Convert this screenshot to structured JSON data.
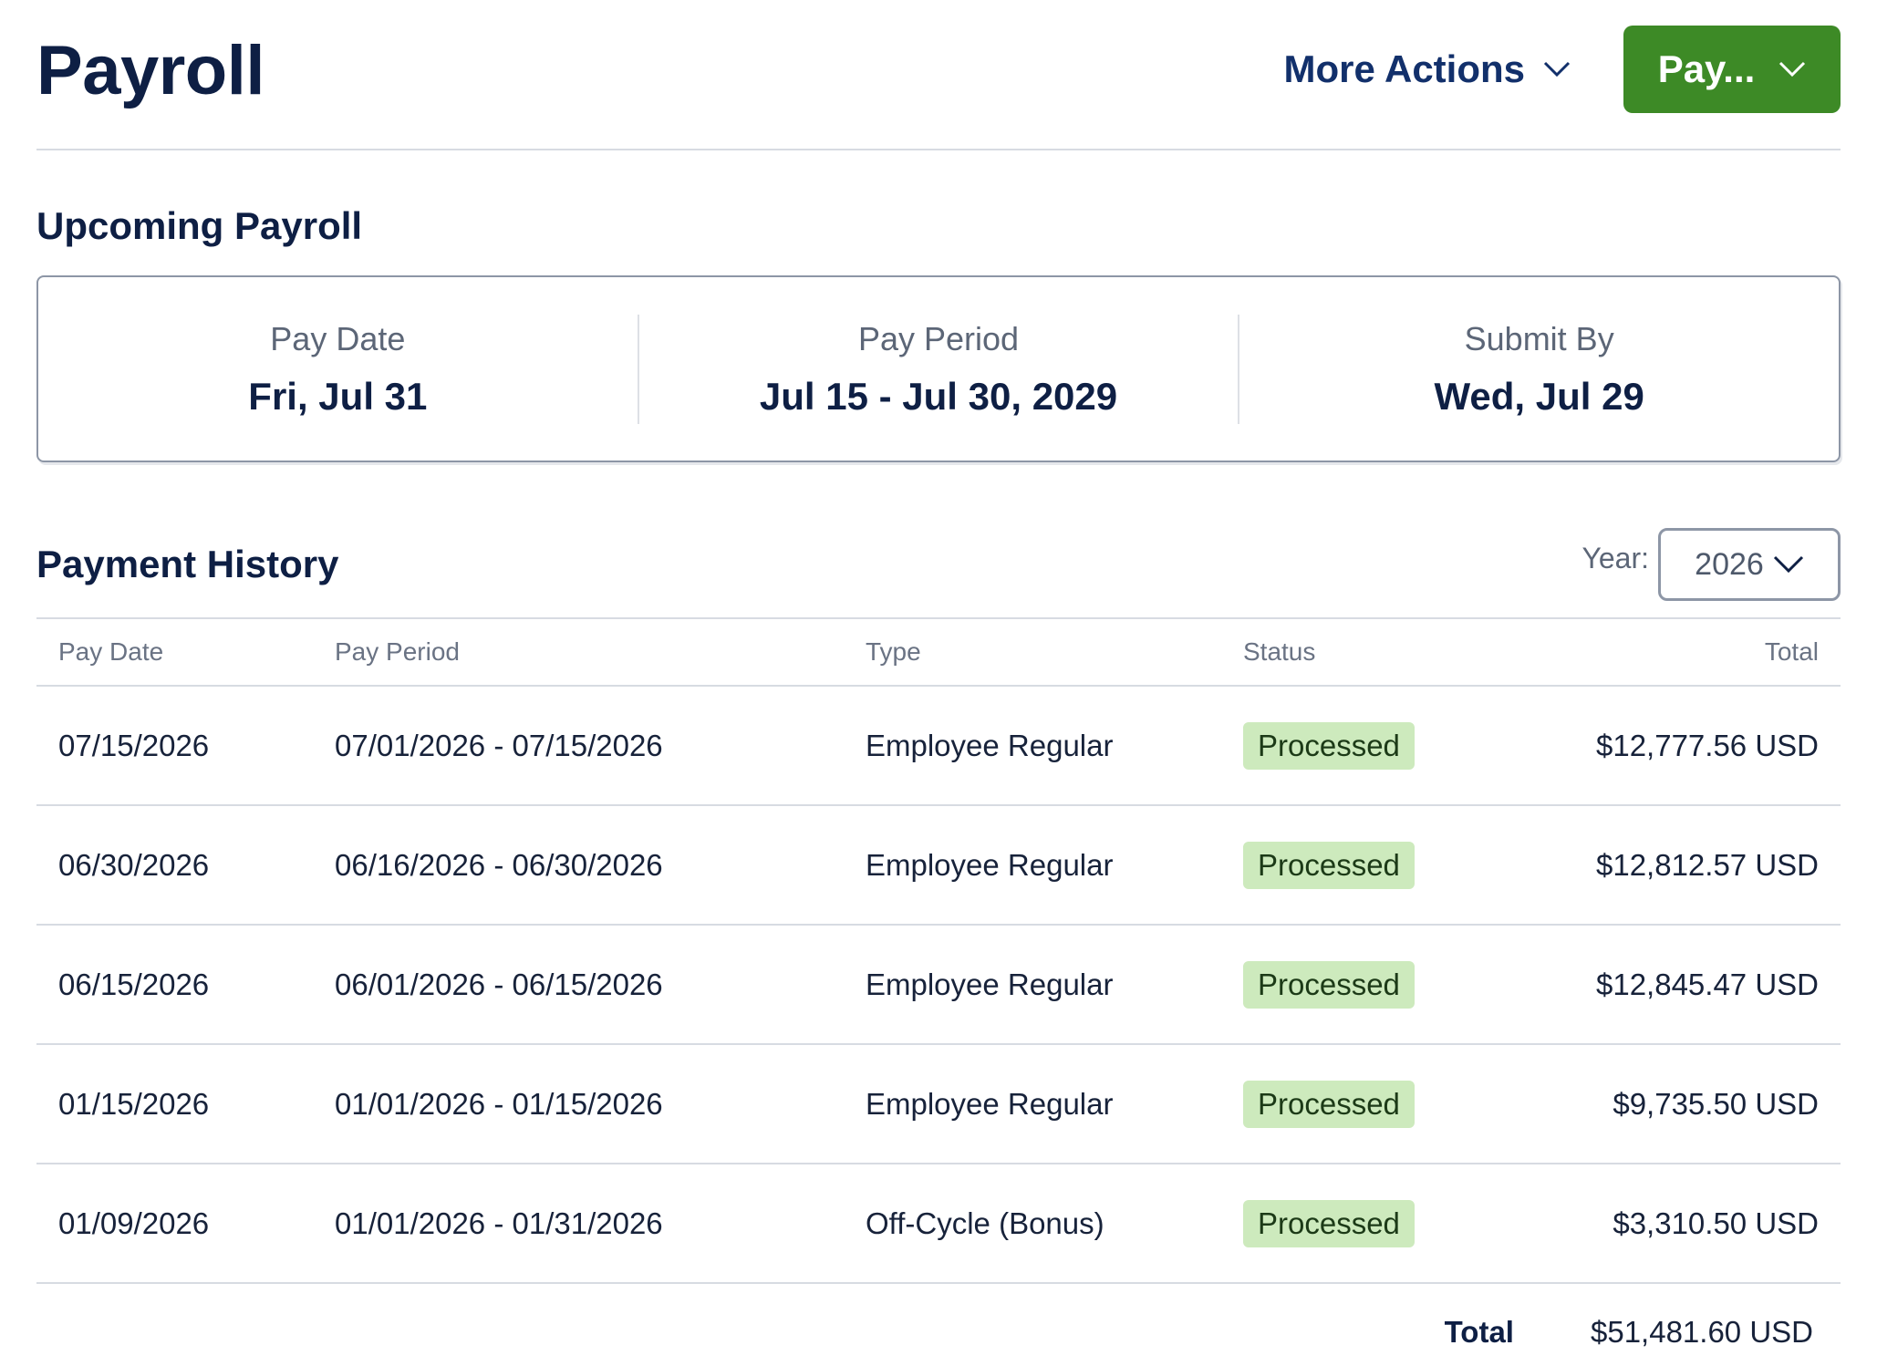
{
  "header": {
    "title": "Payroll",
    "more_actions_label": "More Actions",
    "pay_button_label": "Pay..."
  },
  "upcoming": {
    "title": "Upcoming Payroll",
    "items": [
      {
        "label": "Pay Date",
        "value": "Fri, Jul 31"
      },
      {
        "label": "Pay Period",
        "value": "Jul 15 - Jul 30, 2029"
      },
      {
        "label": "Submit By",
        "value": "Wed, Jul 29"
      }
    ]
  },
  "history": {
    "title": "Payment History",
    "year_label": "Year:",
    "year_value": "2026",
    "columns": [
      "Pay Date",
      "Pay Period",
      "Type",
      "Status",
      "Total"
    ],
    "rows": [
      {
        "date": "07/15/2026",
        "period": "07/01/2026 - 07/15/2026",
        "type": "Employee Regular",
        "status": "Processed",
        "total": "$12,777.56 USD"
      },
      {
        "date": "06/30/2026",
        "period": "06/16/2026 - 06/30/2026",
        "type": "Employee Regular",
        "status": "Processed",
        "total": "$12,812.57 USD"
      },
      {
        "date": "06/15/2026",
        "period": "06/01/2026 - 06/15/2026",
        "type": "Employee Regular",
        "status": "Processed",
        "total": "$12,845.47 USD"
      },
      {
        "date": "01/15/2026",
        "period": "01/01/2026 - 01/15/2026",
        "type": "Employee Regular",
        "status": "Processed",
        "total": "$9,735.50 USD"
      },
      {
        "date": "01/09/2026",
        "period": "01/01/2026 - 01/31/2026",
        "type": "Off-Cycle (Bonus)",
        "status": "Processed",
        "total": "$3,310.50 USD"
      }
    ],
    "total_label": "Total",
    "total_value": "$51,481.60 USD"
  },
  "colors": {
    "primary_text": "#0e1f44",
    "link": "#12306b",
    "pay_button": "#3d8a26",
    "status_badge_bg": "#cdeabd"
  }
}
